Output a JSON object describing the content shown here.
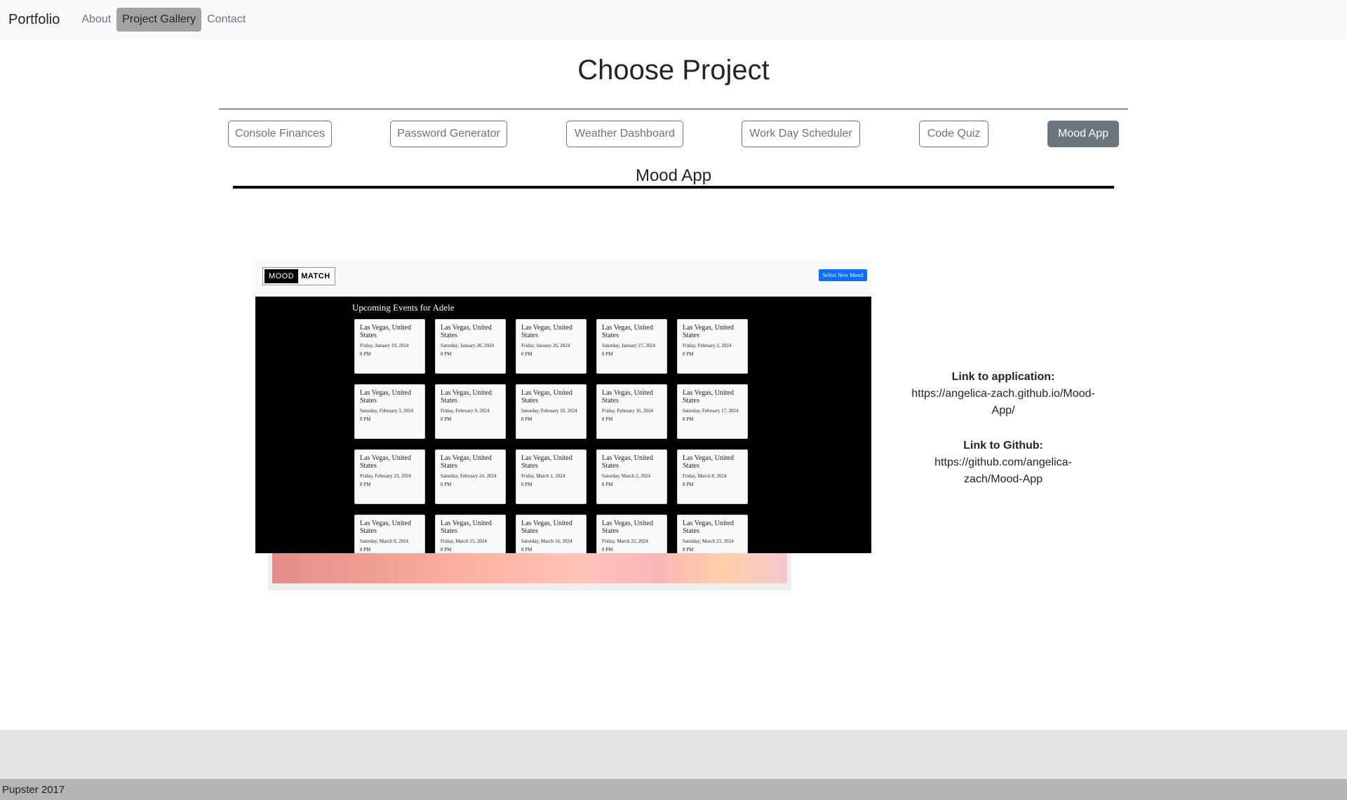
{
  "navbar": {
    "brand": "Portfolio",
    "links": [
      {
        "label": "About"
      },
      {
        "label": "Project Gallery",
        "active": true
      },
      {
        "label": "Contact"
      }
    ]
  },
  "page_title": "Choose Project",
  "projects": [
    {
      "label": "Console Finances"
    },
    {
      "label": "Password Generator"
    },
    {
      "label": "Weather Dashboard"
    },
    {
      "label": "Work Day Scheduler"
    },
    {
      "label": "Code Quiz"
    },
    {
      "label": "Mood App",
      "active": true
    }
  ],
  "selected_project": {
    "title": "Mood App",
    "preview": {
      "logo_left": "MOOD",
      "logo_right": "MATCH",
      "select_button": "Select New Mood",
      "events_title": "Upcoming Events for Adele",
      "cards": [
        {
          "location": "Las Vegas, United States",
          "date": "Friday, January 19, 2024",
          "time": "8 PM"
        },
        {
          "location": "Las Vegas, United States",
          "date": "Saturday, January 20, 2024",
          "time": "8 PM"
        },
        {
          "location": "Las Vegas, United States",
          "date": "Friday, January 26, 2024",
          "time": "8 PM"
        },
        {
          "location": "Las Vegas, United States",
          "date": "Saturday, January 27, 2024",
          "time": "8 PM"
        },
        {
          "location": "Las Vegas, United States",
          "date": "Friday, February 2, 2024",
          "time": "8 PM"
        },
        {
          "location": "Las Vegas, United States",
          "date": "Saturday, February 3, 2024",
          "time": "8 PM"
        },
        {
          "location": "Las Vegas, United States",
          "date": "Friday, February 9, 2024",
          "time": "8 PM"
        },
        {
          "location": "Las Vegas, United States",
          "date": "Saturday, February 10, 2024",
          "time": "8 PM"
        },
        {
          "location": "Las Vegas, United States",
          "date": "Friday, February 16, 2024",
          "time": "8 PM"
        },
        {
          "location": "Las Vegas, United States",
          "date": "Saturday, February 17, 2024",
          "time": "8 PM"
        },
        {
          "location": "Las Vegas, United States",
          "date": "Friday, February 23, 2024",
          "time": "8 PM"
        },
        {
          "location": "Las Vegas, United States",
          "date": "Saturday, February 24, 2024",
          "time": "8 PM"
        },
        {
          "location": "Las Vegas, United States",
          "date": "Friday, March 1, 2024",
          "time": "8 PM"
        },
        {
          "location": "Las Vegas, United States",
          "date": "Saturday, March 2, 2024",
          "time": "8 PM"
        },
        {
          "location": "Las Vegas, United States",
          "date": "Friday, March 8, 2024",
          "time": "8 PM"
        },
        {
          "location": "Las Vegas, United States",
          "date": "Saturday, March 9, 2024",
          "time": "8 PM"
        },
        {
          "location": "Las Vegas, United States",
          "date": "Friday, March 15, 2024",
          "time": "8 PM"
        },
        {
          "location": "Las Vegas, United States",
          "date": "Saturday, March 16, 2024",
          "time": "8 PM"
        },
        {
          "location": "Las Vegas, United States",
          "date": "Friday, March 22, 2024",
          "time": "8 PM"
        },
        {
          "location": "Las Vegas, United States",
          "date": "Saturday, March 23, 2024",
          "time": "8 PM"
        }
      ]
    },
    "app_link_label": "Link to application:",
    "app_link_line1": "https://angelica-zach.github.io/Mood-",
    "app_link_line2": "App/",
    "github_link_label": "Link to Github:",
    "github_link_line1": "https://github.com/angelica-",
    "github_link_line2": "zach/Mood-App"
  },
  "footer": {
    "text": "Pupster 2017"
  }
}
